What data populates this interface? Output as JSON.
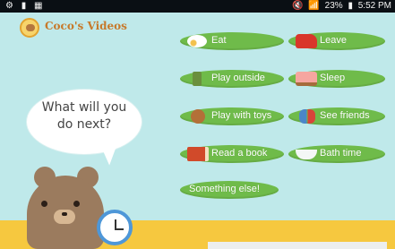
{
  "status_bar": {
    "left_icons": "⚙ ▮ ▦",
    "mute_icon": "🔇",
    "wifi_icon": "📶",
    "battery": "23%",
    "battery_icon": "▮",
    "time": "5:52 PM"
  },
  "app": {
    "title": "Coco's Videos"
  },
  "prompt": {
    "line1": "What will you",
    "line2": "do next?"
  },
  "choices": [
    {
      "label": "Eat",
      "icon": "plate-icon"
    },
    {
      "label": "Leave",
      "icon": "car-icon"
    },
    {
      "label": "Play outside",
      "icon": "door-icon"
    },
    {
      "label": "Sleep",
      "icon": "bed-icon"
    },
    {
      "label": "Play with toys",
      "icon": "teddy-bear-icon"
    },
    {
      "label": "See friends",
      "icon": "friends-icon"
    },
    {
      "label": "Read a book",
      "icon": "book-icon"
    },
    {
      "label": "Bath time",
      "icon": "bathtub-icon"
    },
    {
      "label": "Something else!"
    }
  ],
  "colors": {
    "background": "#bfe9ea",
    "pill": "#6fbb4a",
    "ground": "#f6c83f",
    "title": "#c7792a"
  }
}
